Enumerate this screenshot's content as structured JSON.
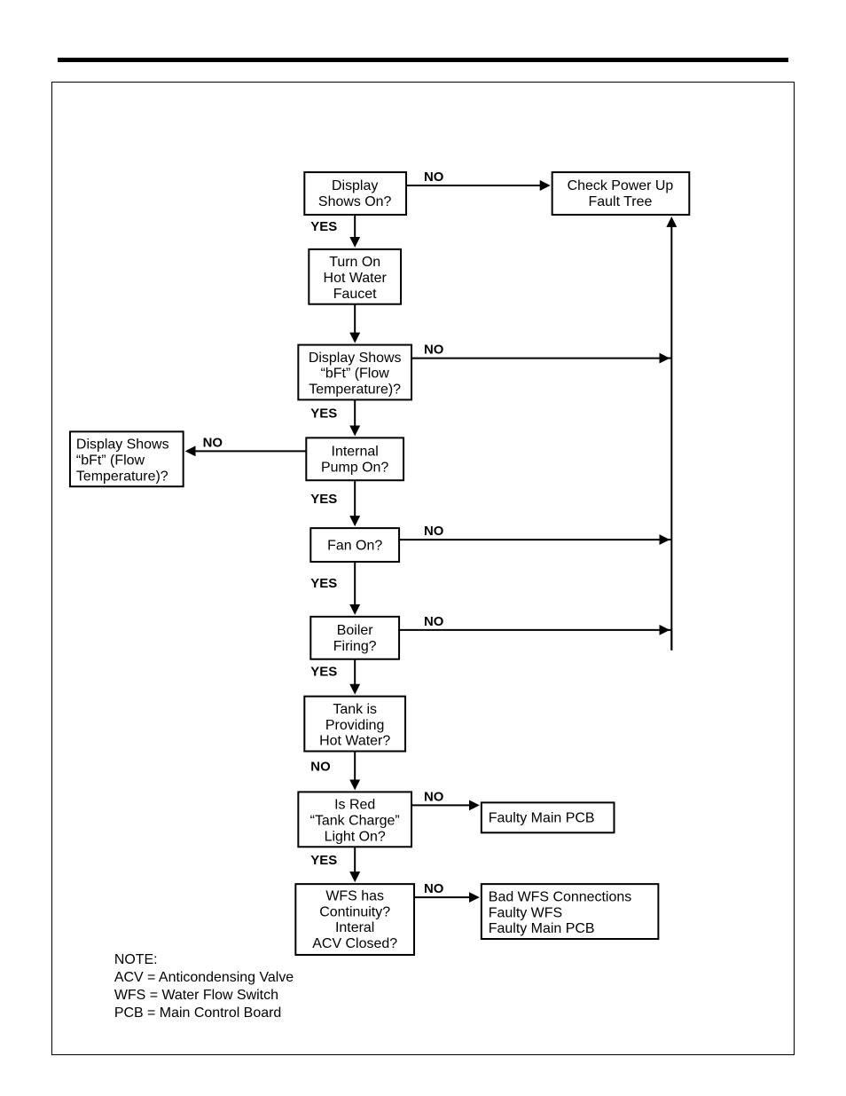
{
  "answers": {
    "yes": "YES",
    "no": "NO"
  },
  "nodes": {
    "n1": {
      "lines": [
        "Display",
        "Shows On?"
      ]
    },
    "n2": {
      "lines": [
        "Check Power Up",
        "Fault Tree"
      ]
    },
    "n3": {
      "lines": [
        "Turn On",
        "Hot Water",
        "Faucet"
      ]
    },
    "n4": {
      "lines": [
        "Display Shows",
        "“bFt” (Flow",
        "Temperature)?"
      ]
    },
    "n5": {
      "lines": [
        "Internal",
        "Pump On?"
      ]
    },
    "n5no": {
      "lines": [
        "Display Shows",
        "“bFt” (Flow",
        "Temperature)?"
      ]
    },
    "n6": {
      "lines": [
        "Fan On?"
      ]
    },
    "n7": {
      "lines": [
        "Boiler",
        "Firing?"
      ]
    },
    "n8": {
      "lines": [
        "Tank is",
        "Providing",
        "Hot Water?"
      ]
    },
    "n9": {
      "lines": [
        "Is Red",
        "“Tank Charge”",
        "Light On?"
      ]
    },
    "n9no": {
      "lines": [
        "Faulty Main PCB"
      ]
    },
    "n10": {
      "lines": [
        "WFS has",
        "Continuity?",
        "Interal",
        "ACV Closed?"
      ]
    },
    "n10no": {
      "lines": [
        "Bad WFS Connections",
        "Faulty WFS",
        "Faulty Main PCB"
      ]
    }
  },
  "note": {
    "title": "NOTE:",
    "lines": [
      "ACV = Anticondensing Valve",
      "WFS = Water Flow Switch",
      "PCB = Main Control Board"
    ]
  }
}
